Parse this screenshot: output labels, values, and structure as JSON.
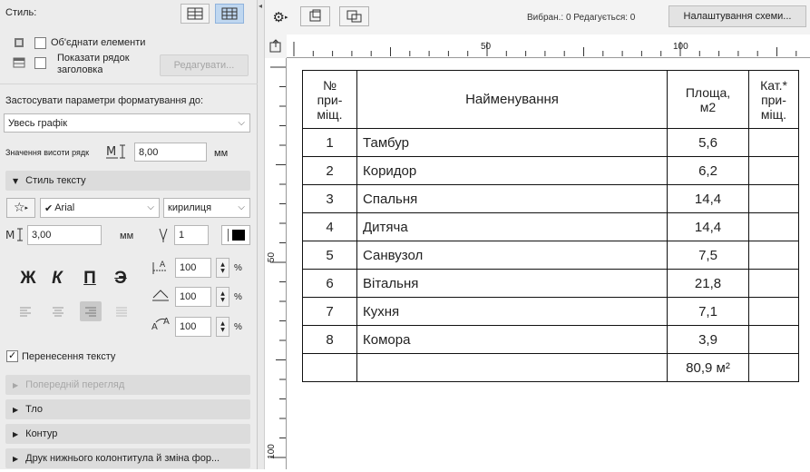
{
  "panel": {
    "style_label": "Стиль:",
    "merge_elements_label": "Об'єднати елементи",
    "show_header_label_1": "Показати рядок",
    "show_header_label_2": "заголовка",
    "edit_button": "Редагувати...",
    "apply_format_label": "Застосувати параметри форматування до:",
    "apply_target": "Увесь графік",
    "row_height_label": "Значення висоти рядк",
    "row_height_value": "8,00",
    "row_height_unit": "мм",
    "text_style_section": "Стиль тексту",
    "font_name": "Arial",
    "charset": "кирилиця",
    "text_size_value": "3,00",
    "text_size_unit": "мм",
    "pen_value": "1",
    "format_buttons": [
      "Ж",
      "К",
      "П",
      "Э"
    ],
    "spacing_values": [
      "100",
      "100",
      "100"
    ],
    "percent": "%",
    "wrap_text_label": "Перенесення тексту",
    "sections": [
      "Попередній перегляд",
      "Тло",
      "Контур",
      "Друк нижнього колонтитула й зміна фор..."
    ]
  },
  "toolbar": {
    "status_text": "Вибран.: 0  Редагується: 0",
    "settings_button": "Налаштування схеми..."
  },
  "ruler": {
    "top_labels": [
      "50",
      "100"
    ],
    "left_labels": [
      "50",
      "100"
    ]
  },
  "schedule": {
    "headers": [
      "№ при-міщ.",
      "Найменування",
      "Площа, м2",
      "Кат.* при-міщ."
    ],
    "header_lines": [
      [
        "№",
        "при-",
        "міщ."
      ],
      [
        "Найменування"
      ],
      [
        "Площа,",
        "м2"
      ],
      [
        "Кат.*",
        "при-",
        "міщ."
      ]
    ],
    "rows": [
      {
        "num": "1",
        "name": "Тамбур",
        "area": "5,6",
        "cat": ""
      },
      {
        "num": "2",
        "name": "Коридор",
        "area": "6,2",
        "cat": ""
      },
      {
        "num": "3",
        "name": "Спальня",
        "area": "14,4",
        "cat": ""
      },
      {
        "num": "4",
        "name": "Дитяча",
        "area": "14,4",
        "cat": ""
      },
      {
        "num": "5",
        "name": "Санвузол",
        "area": "7,5",
        "cat": ""
      },
      {
        "num": "6",
        "name": "Вітальня",
        "area": "21,8",
        "cat": ""
      },
      {
        "num": "7",
        "name": "Кухня",
        "area": "7,1",
        "cat": ""
      },
      {
        "num": "8",
        "name": "Комора",
        "area": "3,9",
        "cat": ""
      }
    ],
    "total": "80,9 м²"
  }
}
